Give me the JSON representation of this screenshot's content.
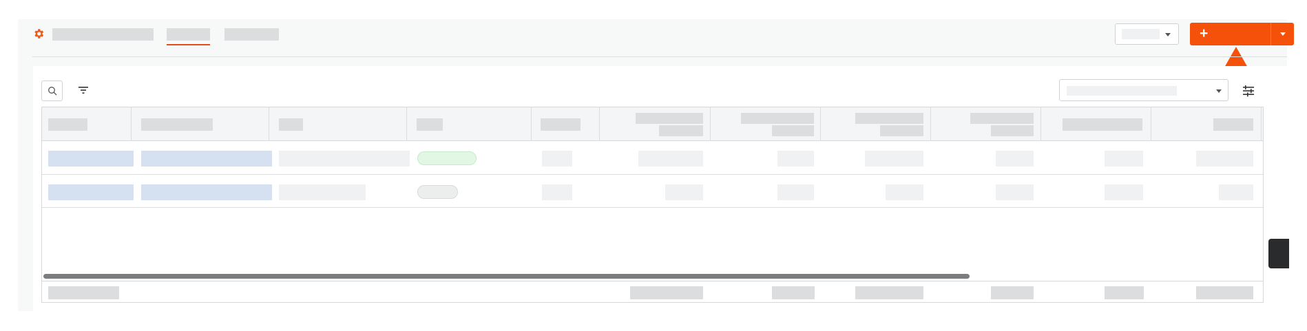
{
  "header": {
    "gear_icon": "gear-icon",
    "accent_color": "#f5510a",
    "tabs": [
      {
        "name": "tab-1",
        "active": false
      },
      {
        "name": "tab-2",
        "active": true
      },
      {
        "name": "tab-3",
        "active": false
      }
    ],
    "add_button": {
      "label": "+"
    }
  },
  "toolbar": {
    "search_icon": "search-icon",
    "filter_icon": "filter-icon",
    "settings_icon": "sliders-icon"
  },
  "table": {
    "columns": 13,
    "rows": 2,
    "row_status": [
      "success",
      "neutral"
    ],
    "status_colors": {
      "success": "#e3f7e5",
      "neutral": "#eceded"
    },
    "has_total_row": true,
    "has_horizontal_scrollbar": true
  }
}
